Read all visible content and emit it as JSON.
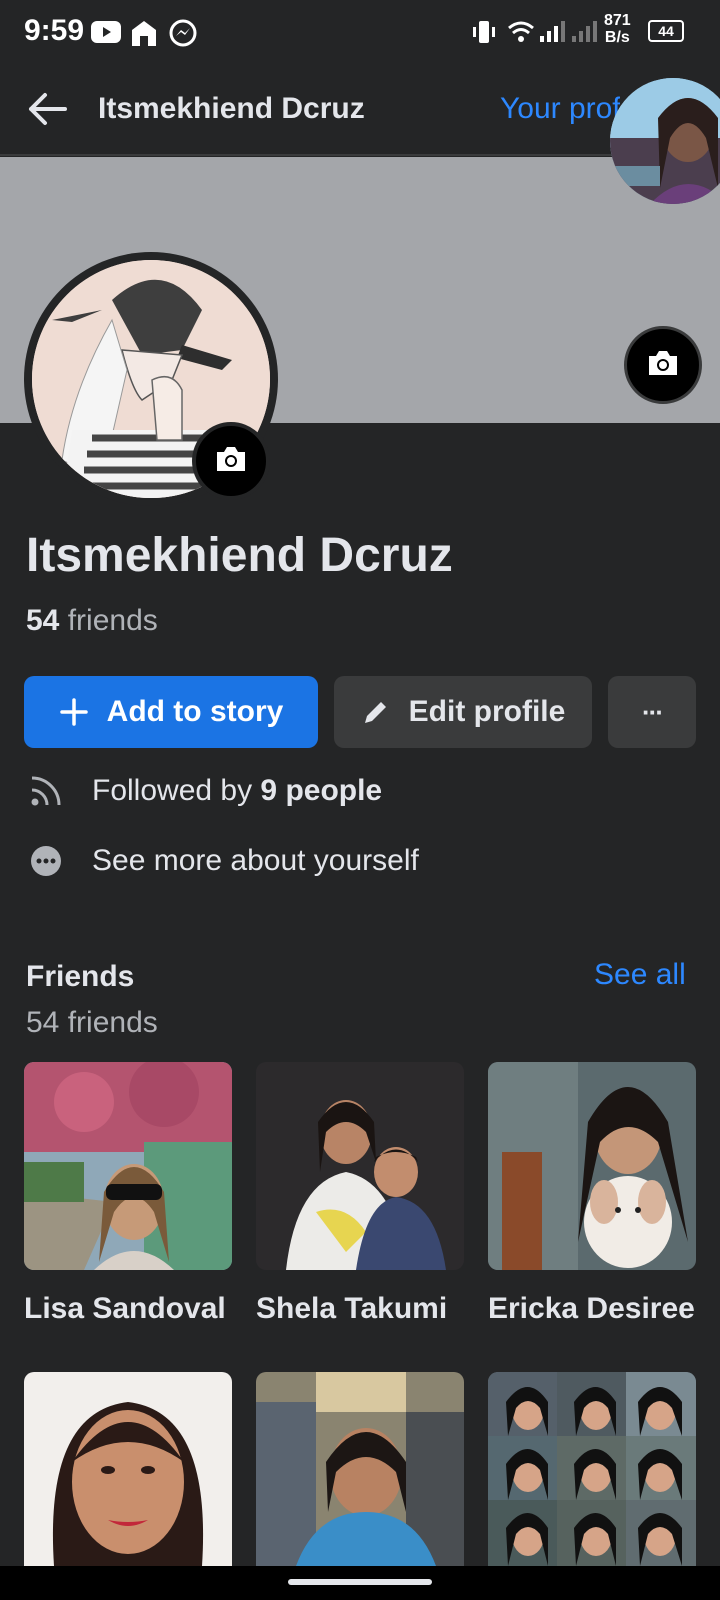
{
  "status_bar": {
    "time": "9:59",
    "net_speed_value": "871",
    "net_speed_unit": "B/s",
    "battery": "44"
  },
  "header": {
    "title": "Itsmekhiend Dcruz",
    "your_profile_link": "Your profile"
  },
  "profile": {
    "name": "Itsmekhiend Dcruz",
    "friends_count": "54",
    "friends_label": "friends"
  },
  "actions": {
    "add_to_story": "Add to story",
    "edit_profile": "Edit profile",
    "more": "···"
  },
  "info": {
    "followed_prefix": "Followed by",
    "followed_count": "9 people",
    "see_more": "See more about yourself"
  },
  "friends_section": {
    "title": "Friends",
    "subtitle": "54 friends",
    "see_all": "See all",
    "items": [
      {
        "name": "Lisa Sandoval"
      },
      {
        "name": "Shela Takumi"
      },
      {
        "name": "Ericka Desiree"
      },
      {
        "name": ""
      },
      {
        "name": ""
      },
      {
        "name": ""
      }
    ]
  },
  "icons": [
    "arrow-left-icon",
    "camera-icon",
    "plus-icon",
    "pencil-icon",
    "ellipsis-icon",
    "rss-icon",
    "more-circle-icon",
    "youtube-icon",
    "home-icon",
    "messenger-icon",
    "vibrate-icon",
    "wifi-icon",
    "signal-icon",
    "battery-icon"
  ],
  "colors": {
    "background": "#242526",
    "accent": "#1b74e4",
    "link": "#2d88ff",
    "cover": "#a4a6aa",
    "button_secondary": "#3a3b3c"
  }
}
